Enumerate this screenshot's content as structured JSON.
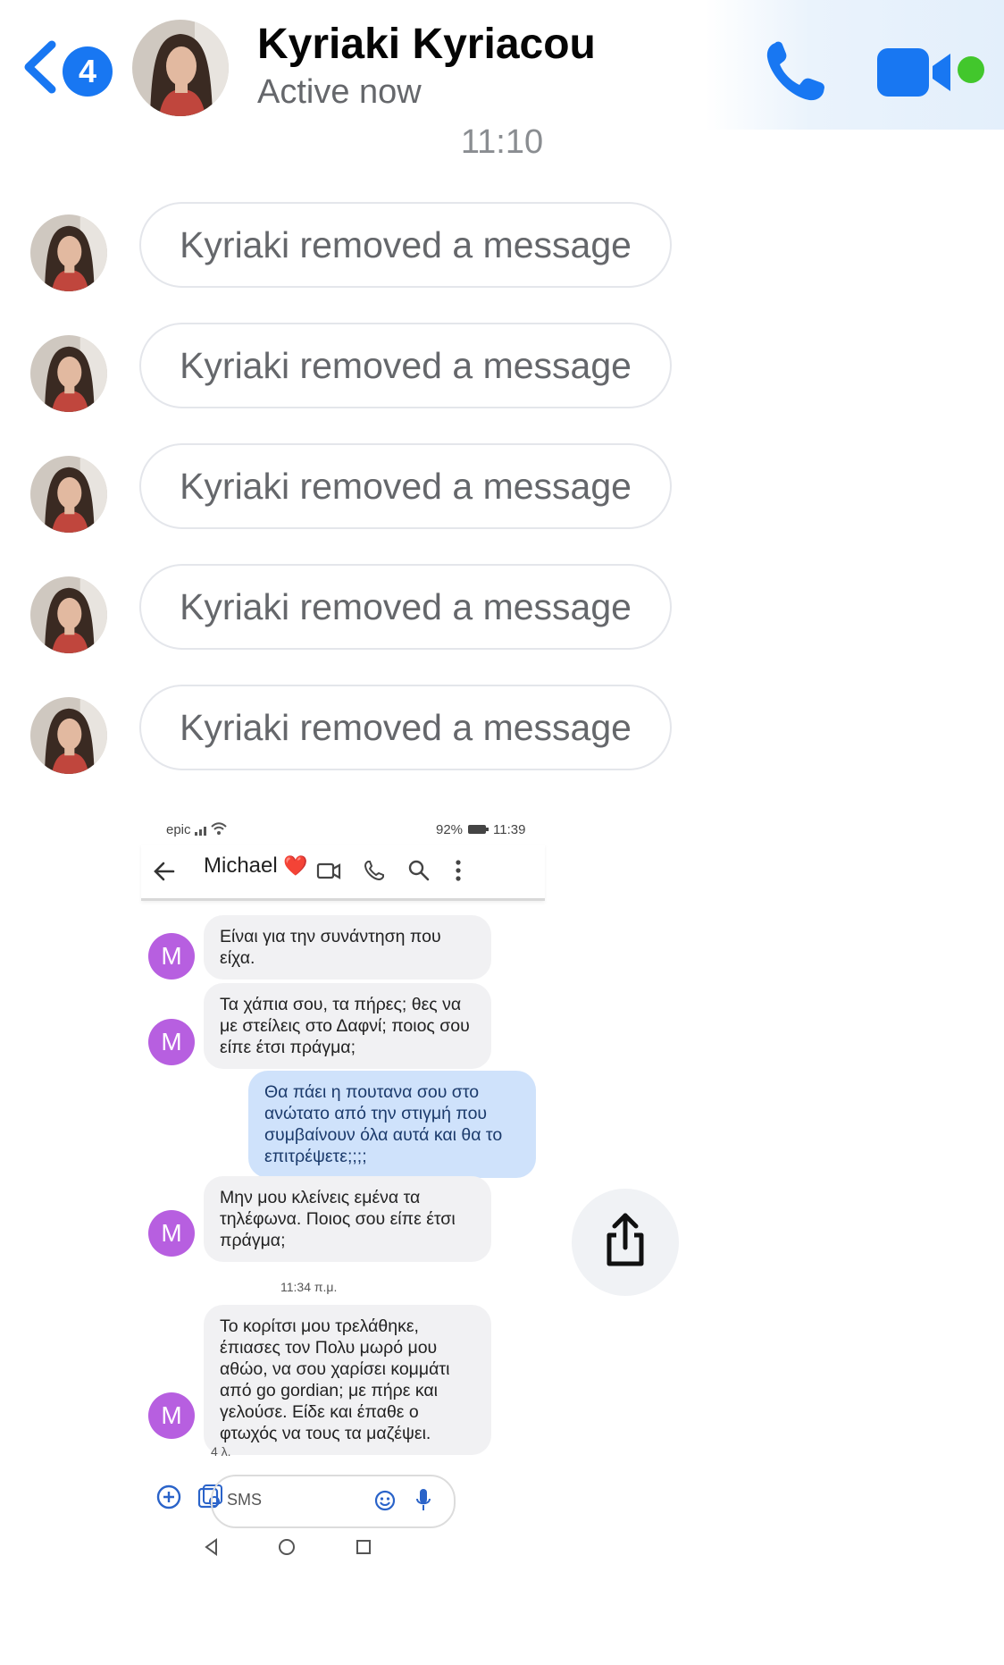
{
  "header": {
    "back_badge_count": "4",
    "contact_name": "Kyriaki Kyriacou",
    "status": "Active now",
    "icons": {
      "back": "chevron-left-icon",
      "phone": "phone-icon",
      "video": "video-camera-icon"
    },
    "accent_color": "#1877f2",
    "online_color": "#42c72c"
  },
  "conversation": {
    "timestamp": "11:10",
    "removed_messages": [
      {
        "text": "Kyriaki removed a message"
      },
      {
        "text": "Kyriaki removed a message"
      },
      {
        "text": "Kyriaki removed a message"
      },
      {
        "text": "Kyriaki removed a message"
      },
      {
        "text": "Kyriaki removed a message"
      }
    ]
  },
  "attachment": {
    "status_bar": {
      "carrier": "epic",
      "battery": "92%",
      "time": "11:39"
    },
    "sms_app": {
      "contact_name": "Michael",
      "contact_emoji": "❤️",
      "avatar_letter": "M",
      "messages": [
        {
          "direction": "in",
          "text": "Είναι για την συνάντηση που είχα."
        },
        {
          "direction": "in",
          "text": "Τα χάπια σου, τα πήρες; θες να με στείλεις στο Δαφνί; ποιος σου είπε έτσι πράγμα;"
        },
        {
          "direction": "out",
          "text": "Θα πάει η πουτανα σου στο ανώτατο από την στιγμή που συμβαίνουν όλα αυτά και θα το επιτρέψετε;;;;"
        },
        {
          "direction": "in",
          "text": "Μην μου κλείνεις εμένα τα τηλέφωνα. Ποιος σου είπε έτσι πράγμα;"
        },
        {
          "direction": "in",
          "text": "Το κορίτσι μου τρελάθηκε, έπιασες τον Πολυ μωρό μου αθώο, να σου χαρίσει κομμάτι από go gordian; με πήρε και γελούσε. Είδε και έπαθε ο φτωχός να τους τα μαζέψει."
        }
      ],
      "timestamp_divider": "11:34 π.μ.",
      "last_message_age": "4 λ.",
      "input_placeholder": "SMS"
    }
  }
}
